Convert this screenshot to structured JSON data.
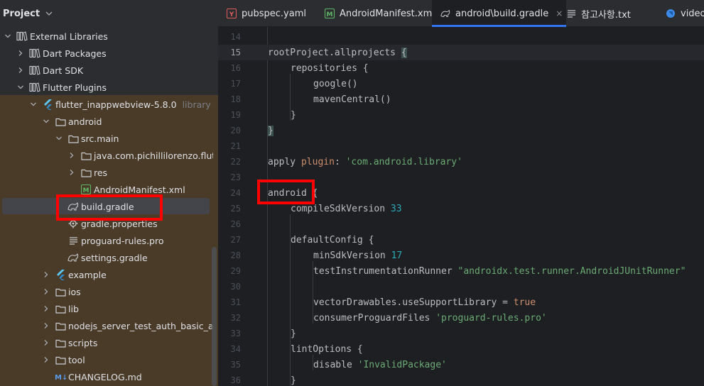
{
  "panel": {
    "title": "Project"
  },
  "tree": [
    {
      "label": "External Libraries",
      "depth": 0,
      "arrow": "down",
      "icon": "library-icon"
    },
    {
      "label": "Dart Packages",
      "depth": 1,
      "arrow": "right",
      "icon": "library-icon"
    },
    {
      "label": "Dart SDK",
      "depth": 1,
      "arrow": "right",
      "icon": "library-icon"
    },
    {
      "label": "Flutter Plugins",
      "depth": 1,
      "arrow": "down",
      "icon": "library-icon"
    },
    {
      "label": "flutter_inappwebview-5.8.0",
      "extra": "library root",
      "depth": 2,
      "arrow": "down",
      "icon": "flutter-icon"
    },
    {
      "label": "android",
      "depth": 3,
      "arrow": "down",
      "icon": "folder-icon"
    },
    {
      "label": "src.main",
      "depth": 4,
      "arrow": "down",
      "icon": "folder-icon"
    },
    {
      "label": "java.com.pichillilorenzo.flutter_i",
      "depth": 5,
      "arrow": "right",
      "icon": "folder-icon"
    },
    {
      "label": "res",
      "depth": 5,
      "arrow": "right",
      "icon": "folder-icon"
    },
    {
      "label": "AndroidManifest.xml",
      "depth": 5,
      "arrow": "none",
      "icon": "manifest-icon"
    },
    {
      "label": "build.gradle",
      "depth": 4,
      "arrow": "none",
      "icon": "gradle-icon",
      "selected": true
    },
    {
      "label": "gradle.properties",
      "depth": 4,
      "arrow": "none",
      "icon": "properties-icon"
    },
    {
      "label": "proguard-rules.pro",
      "depth": 4,
      "arrow": "none",
      "icon": "text-file-icon"
    },
    {
      "label": "settings.gradle",
      "depth": 4,
      "arrow": "none",
      "icon": "gradle-icon"
    },
    {
      "label": "example",
      "depth": 3,
      "arrow": "right",
      "icon": "flutter-icon"
    },
    {
      "label": "ios",
      "depth": 3,
      "arrow": "right",
      "icon": "folder-icon"
    },
    {
      "label": "lib",
      "depth": 3,
      "arrow": "right",
      "icon": "folder-icon"
    },
    {
      "label": "nodejs_server_test_auth_basic_and_ssl",
      "depth": 3,
      "arrow": "right",
      "icon": "folder-icon"
    },
    {
      "label": "scripts",
      "depth": 3,
      "arrow": "right",
      "icon": "folder-icon"
    },
    {
      "label": "tool",
      "depth": 3,
      "arrow": "right",
      "icon": "folder-icon"
    },
    {
      "label": "CHANGELOG.md",
      "depth": 3,
      "arrow": "none",
      "icon": "markdown-icon"
    }
  ],
  "tabs": [
    {
      "label": "pubspec.yaml",
      "icon": "yaml-icon"
    },
    {
      "label": "AndroidManifest.xml",
      "icon": "manifest-icon"
    },
    {
      "label": "android\\build.gradle",
      "icon": "gradle-icon",
      "active": true,
      "close": "×"
    },
    {
      "label": "참고사항.txt",
      "icon": "text-file-icon"
    },
    {
      "label": "video_",
      "icon": "dart-icon"
    }
  ],
  "editor": {
    "current_line": 15,
    "lines": [
      {
        "n": 14,
        "indent": 0,
        "tokens": []
      },
      {
        "n": 15,
        "indent": 0,
        "tokens": [
          {
            "t": "rootProject.allprojects "
          },
          {
            "t": "{",
            "c": "brace-match"
          }
        ]
      },
      {
        "n": 16,
        "indent": 1,
        "tokens": [
          {
            "t": "repositories {"
          }
        ]
      },
      {
        "n": 17,
        "indent": 2,
        "tokens": [
          {
            "t": "google()"
          }
        ]
      },
      {
        "n": 18,
        "indent": 2,
        "tokens": [
          {
            "t": "mavenCentral()"
          }
        ]
      },
      {
        "n": 19,
        "indent": 1,
        "tokens": [
          {
            "t": "}"
          }
        ]
      },
      {
        "n": 20,
        "indent": 0,
        "tokens": [
          {
            "t": "}",
            "c": "brace-match"
          }
        ]
      },
      {
        "n": 21,
        "indent": 0,
        "tokens": []
      },
      {
        "n": 22,
        "indent": 0,
        "tokens": [
          {
            "t": "apply "
          },
          {
            "t": "plugin",
            "c": "kw"
          },
          {
            "t": ": "
          },
          {
            "t": "'com.android.library'",
            "c": "str"
          }
        ]
      },
      {
        "n": 23,
        "indent": 0,
        "tokens": []
      },
      {
        "n": 24,
        "indent": 0,
        "tokens": [
          {
            "t": "android "
          },
          {
            "t": "{"
          }
        ]
      },
      {
        "n": 25,
        "indent": 1,
        "tokens": [
          {
            "t": "compileSdkVersion "
          },
          {
            "t": "33",
            "c": "num"
          }
        ]
      },
      {
        "n": 26,
        "indent": 0,
        "tokens": []
      },
      {
        "n": 27,
        "indent": 1,
        "tokens": [
          {
            "t": "defaultConfig {"
          }
        ]
      },
      {
        "n": 28,
        "indent": 2,
        "tokens": [
          {
            "t": "minSdkVersion "
          },
          {
            "t": "17",
            "c": "num"
          }
        ]
      },
      {
        "n": 29,
        "indent": 2,
        "tokens": [
          {
            "t": "testInstrumentationRunner "
          },
          {
            "t": "\"androidx.test.runner.AndroidJUnitRunner\"",
            "c": "str"
          }
        ]
      },
      {
        "n": 30,
        "indent": 0,
        "tokens": []
      },
      {
        "n": 31,
        "indent": 2,
        "tokens": [
          {
            "t": "vectorDrawables.useSupportLibrary = "
          },
          {
            "t": "true",
            "c": "kw"
          }
        ]
      },
      {
        "n": 32,
        "indent": 2,
        "tokens": [
          {
            "t": "consumerProguardFiles "
          },
          {
            "t": "'proguard-rules.pro'",
            "c": "str"
          }
        ]
      },
      {
        "n": 33,
        "indent": 1,
        "tokens": [
          {
            "t": "}"
          }
        ]
      },
      {
        "n": 34,
        "indent": 1,
        "tokens": [
          {
            "t": "lintOptions {"
          }
        ]
      },
      {
        "n": 35,
        "indent": 2,
        "tokens": [
          {
            "t": "disable "
          },
          {
            "t": "'InvalidPackage'",
            "c": "str"
          }
        ]
      },
      {
        "n": 36,
        "indent": 1,
        "tokens": [
          {
            "t": "}"
          }
        ]
      }
    ]
  },
  "colors": {
    "highlight": "#ff0000",
    "accent": "#3574f0",
    "library_root_bg": "#4a3b29"
  }
}
